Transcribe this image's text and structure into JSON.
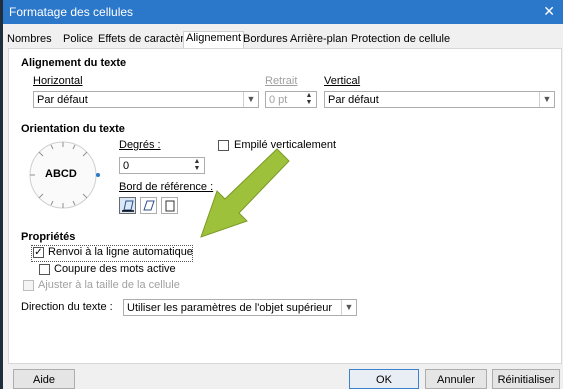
{
  "window": {
    "title": "Formatage des cellules",
    "close_glyph": "✕"
  },
  "tabs": [
    {
      "label": "Nombres"
    },
    {
      "label": "Police"
    },
    {
      "label": "Effets de caractère"
    },
    {
      "label": "Alignement",
      "active": true
    },
    {
      "label": "Bordures"
    },
    {
      "label": "Arrière-plan"
    },
    {
      "label": "Protection de cellule"
    }
  ],
  "alignment": {
    "heading": "Alignement du texte",
    "horizontal_label": "Horizontal",
    "horizontal_value": "Par défaut",
    "indent_label": "Retrait",
    "indent_value": "0 pt",
    "vertical_label": "Vertical",
    "vertical_value": "Par défaut"
  },
  "orientation": {
    "heading": "Orientation du texte",
    "dial_text": "ABCD",
    "degrees_label": "Degrés :",
    "degrees_value": "0",
    "stacked_label": "Empilé verticalement",
    "reference_label": "Bord de référence :"
  },
  "properties": {
    "heading": "Propriétés",
    "wrap_label": "Renvoi à la ligne automatique",
    "hyphen_label": "Coupure des mots active",
    "shrink_label": "Ajuster à la taille de la cellule",
    "direction_label": "Direction du texte :",
    "direction_value": "Utiliser les paramètres de l'objet supérieur"
  },
  "buttons": {
    "help": "Aide",
    "ok": "OK",
    "cancel": "Annuler",
    "reset": "Réinitialiser"
  },
  "colors": {
    "titlebar": "#2b77c9",
    "arrow": "#9ec13c"
  }
}
